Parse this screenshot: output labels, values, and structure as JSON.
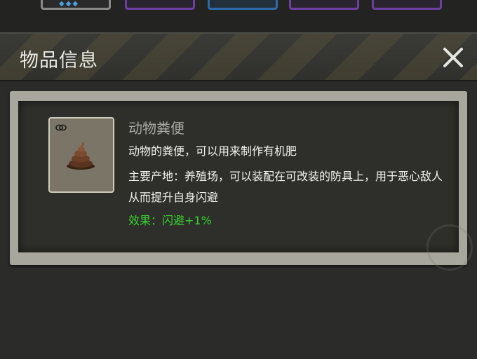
{
  "dialog": {
    "title": "物品信息",
    "close_icon": "close-icon",
    "item": {
      "icon": "manure-icon",
      "name": "动物粪便",
      "description_line1": "动物的粪便，可以用来制作有机肥",
      "description_line2": "主要产地：养殖场，可以装配在可改装的防具上，用于恶心敌人从而提升自身闪避",
      "effect": "效果：闪避+1%"
    }
  },
  "colors": {
    "effect": "#36d431",
    "title": "#e9e9e4",
    "panel_border": "#a8a79d"
  }
}
